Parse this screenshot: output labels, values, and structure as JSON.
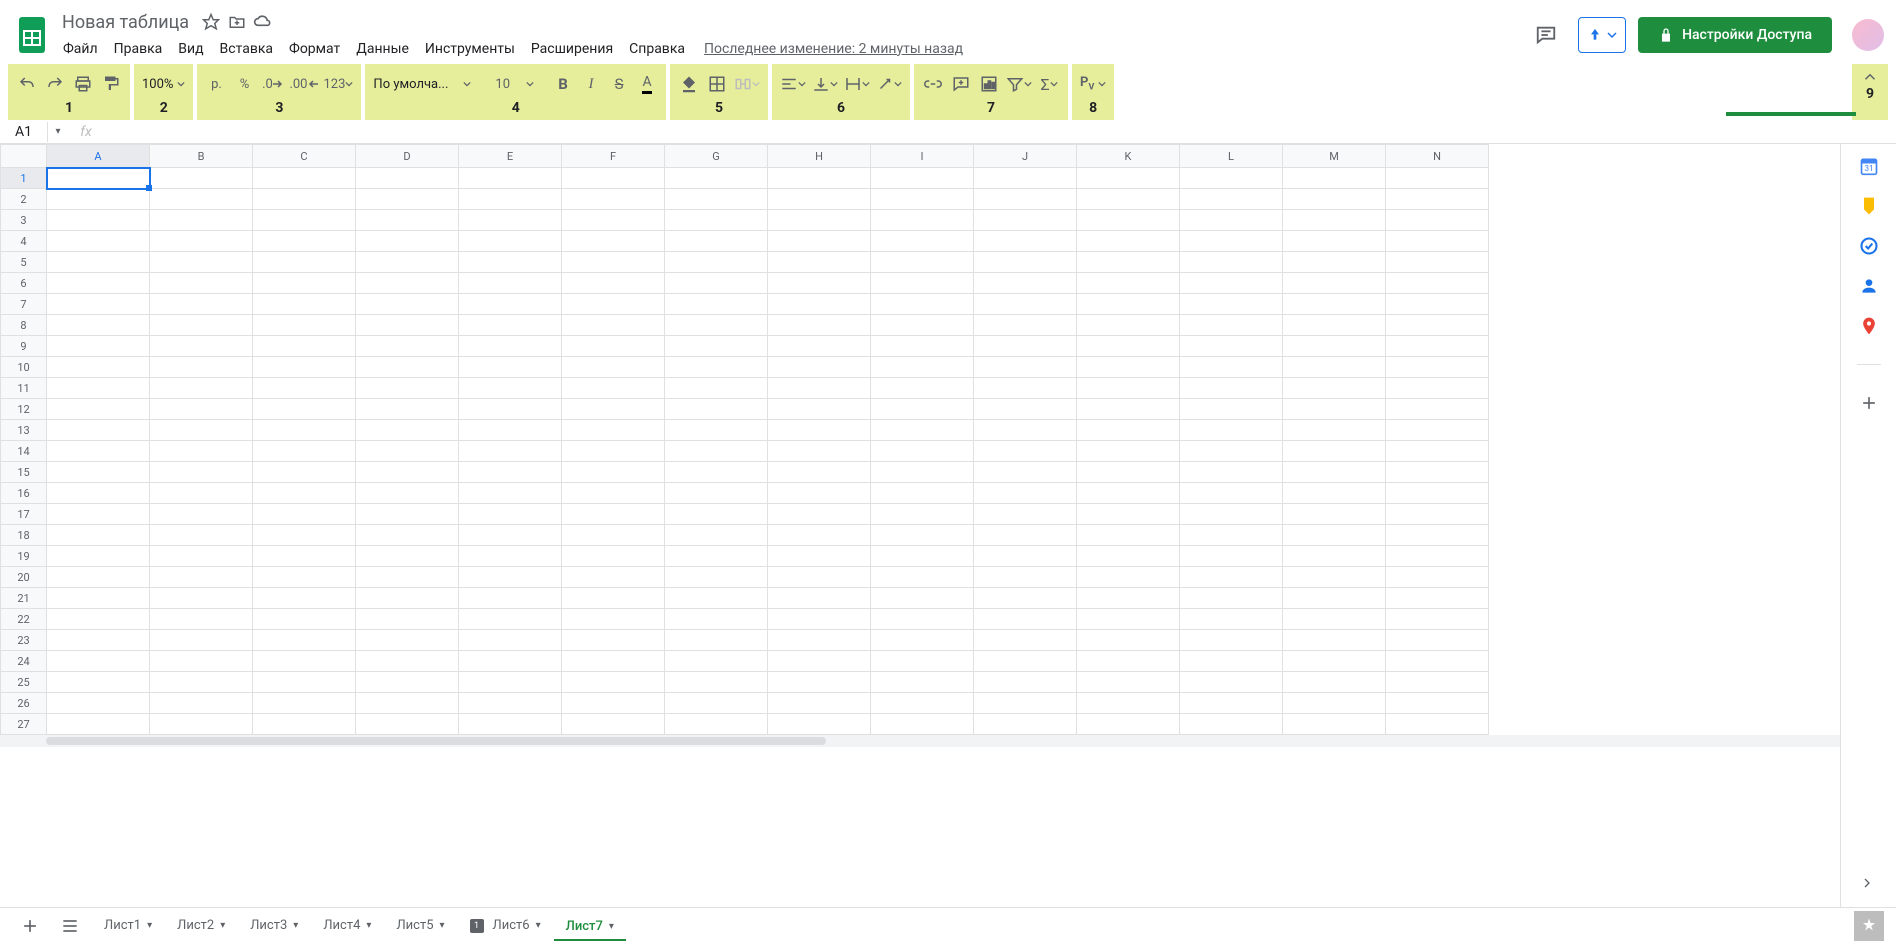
{
  "doc": {
    "title": "Новая таблица"
  },
  "menu": {
    "items": [
      "Файл",
      "Правка",
      "Вид",
      "Вставка",
      "Формат",
      "Данные",
      "Инструменты",
      "Расширения",
      "Справка"
    ],
    "last_edit": "Последнее изменение: 2 минуты назад"
  },
  "share": {
    "label": "Настройки Доступа"
  },
  "toolbar": {
    "zoom": "100%",
    "currency": "р.",
    "percent": "%",
    "dec_less": ".0",
    "dec_more": ".00",
    "num_format": "123",
    "font": "По умолча...",
    "font_size": "10",
    "group_labels": [
      "1",
      "2",
      "3",
      "4",
      "5",
      "6",
      "7",
      "8",
      "9"
    ]
  },
  "formula_bar": {
    "cell_ref": "A1",
    "fx": "fx",
    "value": ""
  },
  "columns": [
    "A",
    "B",
    "C",
    "D",
    "E",
    "F",
    "G",
    "H",
    "I",
    "J",
    "K",
    "L",
    "M",
    "N"
  ],
  "row_count": 27,
  "selected": {
    "col": "A",
    "row": 1
  },
  "sheets": {
    "tabs": [
      {
        "name": "Лист1",
        "badge": null
      },
      {
        "name": "Лист2",
        "badge": null
      },
      {
        "name": "Лист3",
        "badge": null
      },
      {
        "name": "Лист4",
        "badge": null
      },
      {
        "name": "Лист5",
        "badge": null
      },
      {
        "name": "Лист6",
        "badge": "1"
      },
      {
        "name": "Лист7",
        "badge": null
      }
    ],
    "active_index": 6
  }
}
